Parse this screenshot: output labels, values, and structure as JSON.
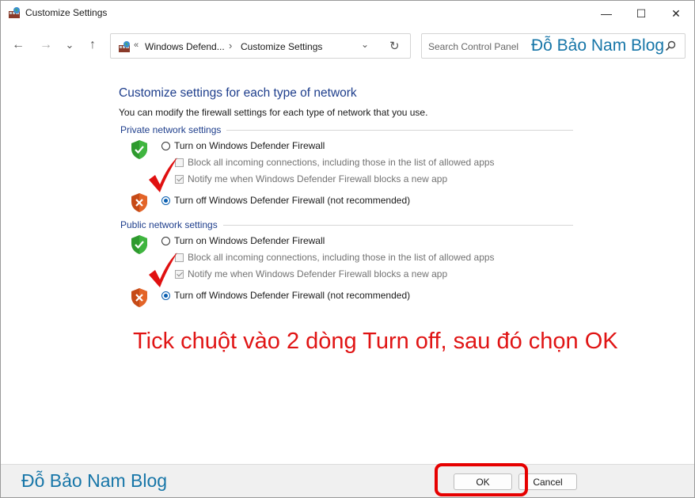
{
  "window": {
    "title": "Customize Settings",
    "controls": {
      "minimize": "—",
      "maximize": "☐",
      "close": "✕"
    }
  },
  "nav": {
    "back_icon": "←",
    "forward_icon": "→",
    "recent_icon": "⌄",
    "up_icon": "↑"
  },
  "address": {
    "overflow": "«",
    "crumbs": [
      "Windows Defend...",
      "Customize Settings"
    ],
    "separator": "›",
    "dropdown_icon": "⌄",
    "refresh_icon": "↻"
  },
  "search": {
    "placeholder": "Search Control Panel",
    "watermark": "Đỗ Bảo Nam Blog"
  },
  "content": {
    "heading": "Customize settings for each type of network",
    "description": "You can modify the firewall settings for each type of network that you use.",
    "private": {
      "label": "Private network settings",
      "turn_on": "Turn on Windows Defender Firewall",
      "block_all": "Block all incoming connections, including those in the list of allowed apps",
      "notify": "Notify me when Windows Defender Firewall blocks a new app",
      "turn_off": "Turn off Windows Defender Firewall (not recommended)"
    },
    "public": {
      "label": "Public network settings",
      "turn_on": "Turn on Windows Defender Firewall",
      "block_all": "Block all incoming connections, including those in the list of allowed apps",
      "notify": "Notify me when Windows Defender Firewall blocks a new app",
      "turn_off": "Turn off Windows Defender Firewall (not recommended)"
    },
    "instruction": "Tick chuột vào 2 dòng Turn off, sau đó chọn OK"
  },
  "footer": {
    "watermark": "Đỗ Bảo Nam Blog",
    "ok_label": "OK",
    "cancel_label": "Cancel"
  },
  "colors": {
    "accent_blue": "#0a5fb0",
    "heading_blue": "#1e3e8c",
    "annotation_red": "#e01414",
    "watermark_blue": "#1776a8",
    "shield_green": "#2e9a2e",
    "shield_orange": "#d2561e"
  }
}
